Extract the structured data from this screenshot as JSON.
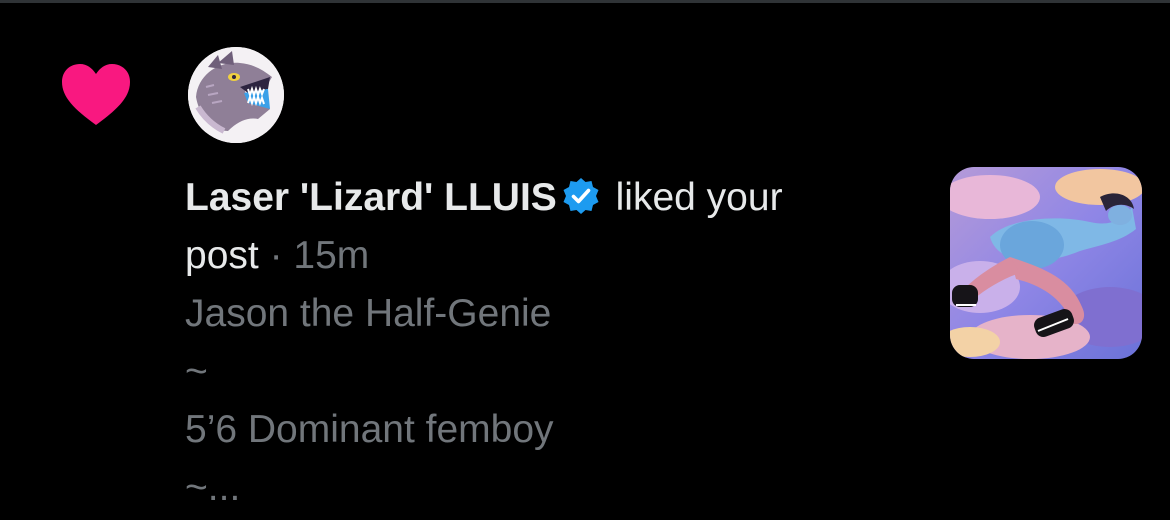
{
  "notification": {
    "type_icon": "heart-icon",
    "icon_color": "#f91880",
    "avatar_icon": "lizard-avatar-icon",
    "user": {
      "display_name": "Laser 'Lizard' LLUIS",
      "verified": true,
      "verified_icon": "verified-badge-icon",
      "verified_color": "#1d9bf0"
    },
    "action": "liked your",
    "action_line2": "post",
    "separator": "·",
    "time": "15m",
    "post_preview": {
      "line1": "Jason the Half-Genie",
      "line2": "~",
      "line3": "5’6 Dominant femboy",
      "line4": "~..."
    },
    "media_thumbnail_icon": "post-image-thumbnail"
  },
  "colors": {
    "background": "#000000",
    "primary_text": "#e7e9ea",
    "secondary_text": "#71767b",
    "divider": "#2f3336"
  }
}
